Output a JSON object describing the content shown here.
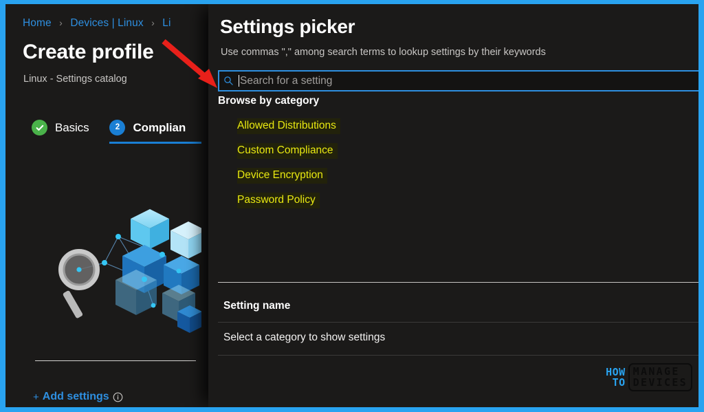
{
  "theme": {
    "frame_border_color": "#29a3f0",
    "page_background": "#1b1a19",
    "accent_blue": "#2e8fe0",
    "category_highlight_text": "#e9e911",
    "category_highlight_background": "#22220b",
    "tab_done_color": "#4ab24a",
    "tab_current_color": "#1a7fd4",
    "annotation_arrow_color": "#e8201a"
  },
  "left_panel": {
    "breadcrumb": {
      "name": "breadcrumb",
      "items": [
        "Home",
        "Devices | Linux",
        "Li"
      ],
      "separator": "›"
    },
    "title": "Create profile",
    "subtitle": "Linux - Settings catalog",
    "tabs": [
      {
        "label": "Basics",
        "badge": "✓",
        "state": "completed",
        "active": false
      },
      {
        "label": "Complian",
        "badge": "2",
        "state": "current",
        "active": true
      }
    ],
    "illustration": {
      "name": "settings-catalog-illustration",
      "description": "magnifying-glass-and-isometric-cubes"
    },
    "add_settings": {
      "plus": "+",
      "label": "Add settings",
      "info_icon": "info-icon"
    }
  },
  "picker": {
    "title": "Settings picker",
    "hint": "Use commas \",\" among search terms to lookup settings by their keywords",
    "search": {
      "icon": "search-icon",
      "placeholder": "Search for a setting",
      "value": ""
    },
    "browse_label": "Browse by category",
    "categories": [
      "Allowed Distributions",
      "Custom Compliance",
      "Device Encryption",
      "Password Policy"
    ],
    "table": {
      "column_header": "Setting name",
      "empty_message": "Select a category to show settings"
    }
  },
  "watermark": {
    "how": "HOW",
    "to": "TO",
    "manage": "MANAGE",
    "devices": "DEVICES"
  }
}
